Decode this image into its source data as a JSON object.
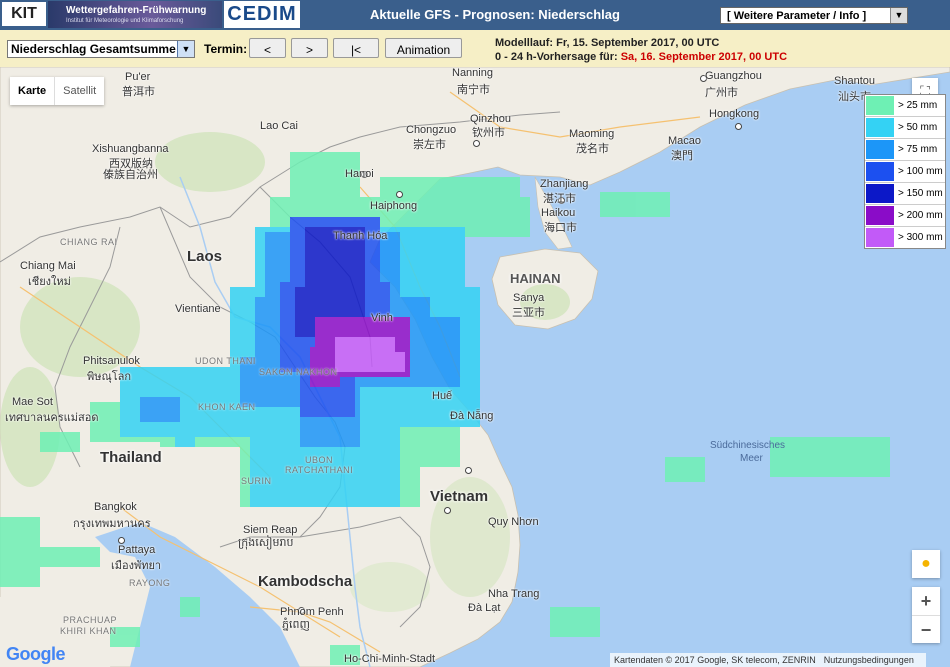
{
  "header": {
    "logo_kit": "KIT",
    "logo_wfw_title": "Wettergefahren-Frühwarnung",
    "logo_wfw_sub": "Institut für Meteorologie und Klimaforschung",
    "logo_cedim": "CEDIM",
    "title": "Aktuelle GFS - Prognosen: Niederschlag",
    "param_select": "[ Weitere Parameter / Info ]"
  },
  "toolbar": {
    "select_value": "Niederschlag Gesamtsumme",
    "termin_label": "Termin:",
    "btn_prev": "<",
    "btn_next": ">",
    "btn_first": "|<",
    "btn_animation": "Animation",
    "run_line": "Modelllauf: Fr, 15. September 2017, 00 UTC",
    "forecast_prefix": "0 - 24 h-Vorhersage für: ",
    "forecast_date": "Sa, 16. September 2017, 00 UTC"
  },
  "map_controls": {
    "type_map": "Karte",
    "type_satellite": "Satellit",
    "zoom_in": "+",
    "zoom_out": "−",
    "google": "Google",
    "attribution": "Kartendaten © 2017 Google, SK telecom, ZENRIN",
    "terms": "Nutzungsbedingungen"
  },
  "legend": [
    {
      "label": "> 25 mm",
      "color": "#6ef0b4"
    },
    {
      "label": "> 50 mm",
      "color": "#34d2f4"
    },
    {
      "label": "> 75 mm",
      "color": "#1c96f8"
    },
    {
      "label": "> 100 mm",
      "color": "#1c50f0"
    },
    {
      "label": "> 150 mm",
      "color": "#0c18c8"
    },
    {
      "label": "> 200 mm",
      "color": "#8a0cc8"
    },
    {
      "label": "> 300 mm",
      "color": "#c25af8"
    }
  ],
  "places": {
    "nanning": "Nanning",
    "nanning_zh": "南宁市",
    "guangzhou": "Guangzhou",
    "guangzhou_zh": "广州市",
    "shantou": "Shantou",
    "shantou_zh": "汕头市",
    "puer": "Pu'er",
    "puer_zh": "普洱市",
    "laocai": "Lao Cai",
    "chongzuo": "Chongzuo",
    "chongzuo_zh": "崇左市",
    "qinzhou": "Qinzhou",
    "qinzhou_zh": "钦州市",
    "maoming": "Maoming",
    "maoming_zh": "茂名市",
    "hongkong": "Hongkong",
    "macao": "Macao",
    "macao_zh": "澳門",
    "xishuangbanna": "Xishuangbanna",
    "xishuangbanna_zh1": "西双版纳",
    "xishuangbanna_zh2": "傣族自治州",
    "hanoi": "Hanoi",
    "haiphong": "Haiphong",
    "zhanjiang": "Zhanjiang",
    "zhanjiang_zh": "湛江市",
    "haikou": "Haikou",
    "haikou_zh": "海口市",
    "chiangrai": "CHIANG RAI",
    "thanhhoa": "Thanh Hóa",
    "laos": "Laos",
    "hainan": "HAINAN",
    "chiangmai": "Chiang Mai",
    "chiangmai_th": "เชียงใหม่",
    "vinh": "Vinh",
    "sanya": "Sanya",
    "sanya_zh": "三亚市",
    "vientiane": "Vientiane",
    "udonthani": "UDON THANI",
    "sakonnakhon": "SAKON NAKHON",
    "phitsanulok": "Phitsanulok",
    "phitsanulok_th": "พิษณุโลก",
    "hue": "Huế",
    "danang": "Đà Nẵng",
    "khonkaen": "KHON KAEN",
    "maesot": "Mae Sot",
    "maesot_th": "เทศบาลนครแม่สอด",
    "sudchin": "Südchinesisches",
    "sudchin2": "Meer",
    "thailand": "Thailand",
    "ubonr": "UBON",
    "ubonr2": "RATCHATHANI",
    "surin": "SURIN",
    "vietnam": "Vietnam",
    "quynhon": "Quy Nhơn",
    "bangkok": "Bangkok",
    "bangkok_th": "กรุงเทพมหานคร",
    "siemreap": "Siem Reap",
    "siemreap_km": "ក្រុងសៀមរាប",
    "pattaya": "Pattaya",
    "pattaya_th": "เมืองพัทยา",
    "rayong": "RAYONG",
    "kambodscha": "Kambodscha",
    "nhatrang": "Nha Trang",
    "phnompenh": "Phnom Penh",
    "phnompenh_km": "ភ្នំពេញ",
    "dalat": "Đà Lạt",
    "prachuap": "PRACHUAP",
    "prachuap2": "KHIRI KHAN",
    "hcmc": "Ho-Chi-Minh-Stadt"
  }
}
